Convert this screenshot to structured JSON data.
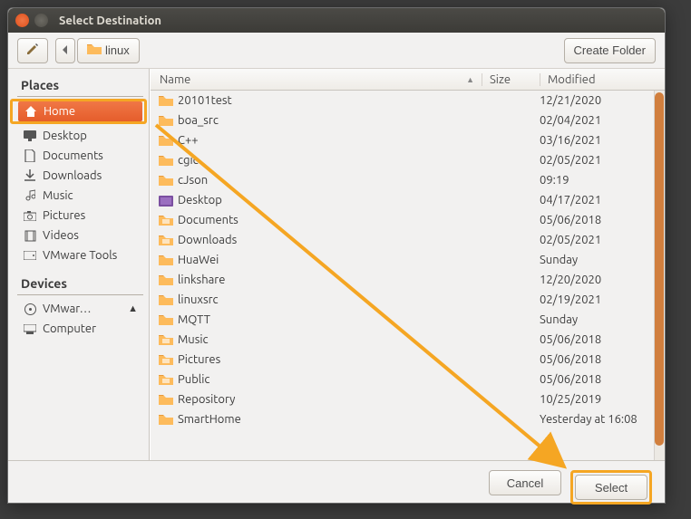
{
  "window": {
    "title": "Select Destination"
  },
  "toolbar": {
    "path_current": "linux",
    "create_folder": "Create Folder"
  },
  "sidebar": {
    "places_head": "Places",
    "devices_head": "Devices",
    "places": [
      {
        "label": "Home",
        "icon": "home",
        "selected": true
      },
      {
        "label": "Desktop",
        "icon": "desktop"
      },
      {
        "label": "Documents",
        "icon": "document"
      },
      {
        "label": "Downloads",
        "icon": "download"
      },
      {
        "label": "Music",
        "icon": "music"
      },
      {
        "label": "Pictures",
        "icon": "camera"
      },
      {
        "label": "Videos",
        "icon": "film"
      },
      {
        "label": "VMware Tools",
        "icon": "drive"
      }
    ],
    "devices": [
      {
        "label": "VMwar…",
        "icon": "disc",
        "eject": true
      },
      {
        "label": "Computer",
        "icon": "computer"
      }
    ]
  },
  "columns": {
    "name": "Name",
    "size": "Size",
    "modified": "Modified"
  },
  "files": [
    {
      "name": "20101test",
      "type": "folder",
      "modified": "12/21/2020"
    },
    {
      "name": "boa_src",
      "type": "folder",
      "modified": "02/04/2021"
    },
    {
      "name": "C++",
      "type": "folder",
      "modified": "03/16/2021"
    },
    {
      "name": "cgic",
      "type": "folder",
      "modified": "02/05/2021"
    },
    {
      "name": "cJson",
      "type": "folder",
      "modified": "09:19"
    },
    {
      "name": "Desktop",
      "type": "special-desktop",
      "modified": "04/17/2021"
    },
    {
      "name": "Documents",
      "type": "special",
      "modified": "05/06/2018"
    },
    {
      "name": "Downloads",
      "type": "special",
      "modified": "02/05/2021"
    },
    {
      "name": "HuaWei",
      "type": "folder",
      "modified": "Sunday"
    },
    {
      "name": "linkshare",
      "type": "folder",
      "modified": "12/20/2020"
    },
    {
      "name": "linuxsrc",
      "type": "folder",
      "modified": "02/19/2021"
    },
    {
      "name": "MQTT",
      "type": "folder",
      "modified": "Sunday"
    },
    {
      "name": "Music",
      "type": "special",
      "modified": "05/06/2018"
    },
    {
      "name": "Pictures",
      "type": "special",
      "modified": "05/06/2018"
    },
    {
      "name": "Public",
      "type": "special",
      "modified": "05/06/2018"
    },
    {
      "name": "Repository",
      "type": "folder",
      "modified": "10/25/2019"
    },
    {
      "name": "SmartHome",
      "type": "folder",
      "modified": "Yesterday at 16:08"
    }
  ],
  "footer": {
    "cancel": "Cancel",
    "select": "Select"
  },
  "annotation": {
    "arrow_color": "#f5a623"
  }
}
